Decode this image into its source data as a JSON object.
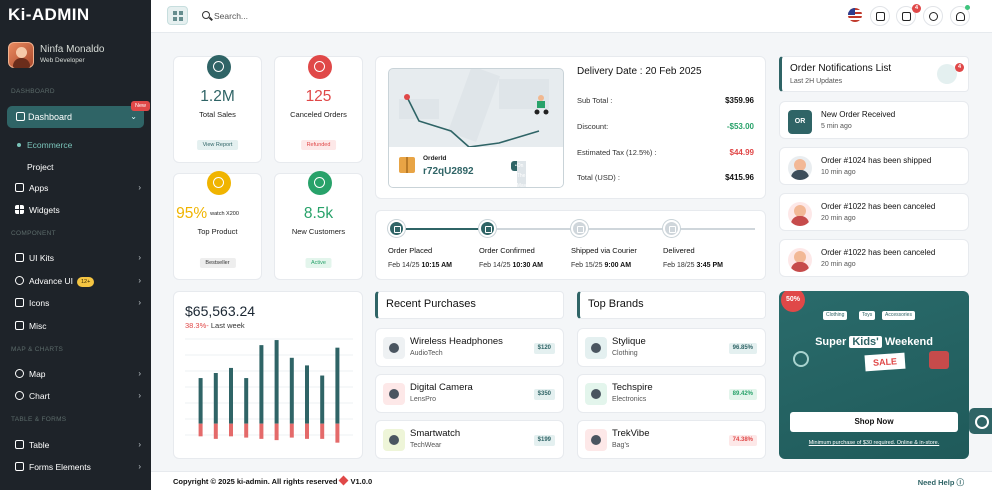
{
  "app": {
    "logo": "Ki-ADMIN"
  },
  "user": {
    "name": "Ninfa Monaldo",
    "role": "Web Developer"
  },
  "sidebar": {
    "section_dashboard": "DASHBOARD",
    "dashboard_label": "Dashboard",
    "new_badge": "New",
    "sub_items": [
      "Ecommerce",
      "Project"
    ],
    "apps": "Apps",
    "widgets": "Widgets",
    "section_component": "COMPONENT",
    "ui_kits": "UI Kits",
    "advance_ui": "Advance UI",
    "advance_ui_badge": "12+",
    "icons": "Icons",
    "misc": "Misc",
    "section_map": "MAP & CHARTS",
    "map": "Map",
    "chart": "Chart",
    "section_table": "TABLE & FORMS",
    "table": "Table",
    "forms": "Forms Elements"
  },
  "topbar": {
    "search_placeholder": "Search...",
    "cart_count": "4"
  },
  "stats": [
    {
      "value": "1.2M",
      "label": "Total Sales",
      "chip": "View Report",
      "color": "#2f6466",
      "chip_bg": "#e4f0f0",
      "chip_fg": "#2f6466"
    },
    {
      "value": "125",
      "label": "Canceled Orders",
      "chip": "Refunded",
      "color": "#e04848",
      "chip_bg": "#fde8e8",
      "chip_fg": "#e04848"
    },
    {
      "value": "95%",
      "watch": "watch X200",
      "label": "Top Product",
      "chip": "Bestseller",
      "color": "#f0b400",
      "chip_bg": "#eeeeee",
      "chip_fg": "#333333"
    },
    {
      "value": "8.5k",
      "label": "New Customers",
      "chip": "Active",
      "color": "#28a26a",
      "chip_bg": "#e3f5ec",
      "chip_fg": "#28a26a"
    }
  ],
  "delivery": {
    "title": "Delivery Date : 20 Feb 2025",
    "order_label": "OrderId",
    "order_id": "r72qU2892",
    "on_the_way": "On The May",
    "rows": [
      {
        "label": "Sub Total :",
        "value": "$359.96",
        "color": "#111111"
      },
      {
        "label": "Discount:",
        "value": "-$53.00",
        "color": "#28a26a"
      },
      {
        "label": "Estimated Tax (12.5%) :",
        "value": "$44.99",
        "color": "#e04848"
      },
      {
        "label": "Total (USD) :",
        "value": "$415.96",
        "color": "#111111"
      }
    ]
  },
  "timeline": [
    {
      "title": "Order Placed",
      "date": "Feb 14/25",
      "time": "10:15 AM",
      "done": true
    },
    {
      "title": "Order Confirmed",
      "date": "Feb 14/25",
      "time": "10:30 AM",
      "done": true
    },
    {
      "title": "Shipped via Courier",
      "date": "Feb 15/25",
      "time": "9:00 AM",
      "done": false
    },
    {
      "title": "Delivered",
      "date": "Feb 18/25",
      "time": "3:45 PM",
      "done": false
    }
  ],
  "revenue": {
    "value": "$65,563.24",
    "change": "38.3%-",
    "period": "Last week"
  },
  "chart_data": {
    "type": "bar",
    "series": [
      {
        "values": [
          36,
          40,
          44,
          36,
          62,
          66,
          52,
          46,
          38,
          60
        ]
      },
      {
        "values": [
          -10,
          -12,
          -10,
          -11,
          -12,
          -13,
          -11,
          -12,
          -12,
          -15
        ]
      }
    ],
    "colors": [
      "#2f6466",
      "#e46a6a"
    ],
    "ylim": [
      -20,
      70
    ],
    "grid": true
  },
  "recent": {
    "title": "Recent Purchases",
    "items": [
      {
        "name": "Wireless Headphones",
        "brand": "AudioTech",
        "price": "$120"
      },
      {
        "name": "Digital Camera",
        "brand": "LensPro",
        "price": "$350"
      },
      {
        "name": "Smartwatch",
        "brand": "TechWear",
        "price": "$199"
      }
    ]
  },
  "brands": {
    "title": "Top Brands",
    "items": [
      {
        "name": "Stylique",
        "cat": "Clothing",
        "pct": "96.85%",
        "bg": "#e4f0f0",
        "fg": "#2f6466"
      },
      {
        "name": "Techspire",
        "cat": "Electronics",
        "pct": "89.42%",
        "bg": "#e3f5ec",
        "fg": "#28a26a"
      },
      {
        "name": "TrekVibe",
        "cat": "Bag's",
        "pct": "74.38%",
        "bg": "#fde8e8",
        "fg": "#e04848"
      }
    ]
  },
  "notifications": {
    "title": "Order Notifications List",
    "sub": "Last 2H Updates",
    "count": "4",
    "items": [
      {
        "title": "New Order Received",
        "time": "5 min ago",
        "initials": "OR"
      },
      {
        "title": "Order #1024 has been shipped",
        "time": "10 min ago"
      },
      {
        "title": "Order #1022 has been canceled",
        "time": "20 min ago"
      },
      {
        "title": "Order #1022 has been canceled",
        "time": "20 min ago"
      }
    ]
  },
  "promo": {
    "badge": "50%",
    "tags": [
      "Clothing",
      "Toys",
      "Accessories"
    ],
    "super": "Super",
    "kids": "Kids'",
    "weekend": "Weekend",
    "sale": "SALE",
    "button": "Shop Now",
    "fine": "Minimum purchase of $30 required. Online & in-store."
  },
  "footer": {
    "copyright": "Copyright © 2025 ki-admin. All rights reserved",
    "version": "V1.0.0",
    "help": "Need Help"
  }
}
